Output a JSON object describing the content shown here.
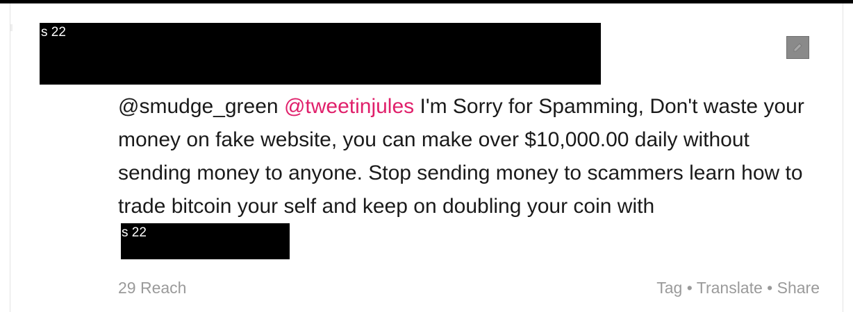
{
  "header": {
    "redaction_label": "s 22"
  },
  "edit_icon": "pencil-icon",
  "tweet": {
    "mention_1": "@smudge_green",
    "mention_2": "@tweetinjules",
    "body": " I'm Sorry for Spamming, Don't waste your money on fake website, you can make over $10,000.00 daily without sending money to anyone. Stop sending money to scammers learn how to trade bitcoin your self and keep on doubling your coin with",
    "inline_redaction_label": "s 22"
  },
  "footer": {
    "reach": "29 Reach",
    "tag_label": "Tag",
    "translate_label": "Translate",
    "share_label": "Share",
    "separator": "•"
  },
  "colors": {
    "mention_highlight": "#e0206b",
    "meta_text": "#9a9a9a",
    "redaction": "#000000"
  }
}
